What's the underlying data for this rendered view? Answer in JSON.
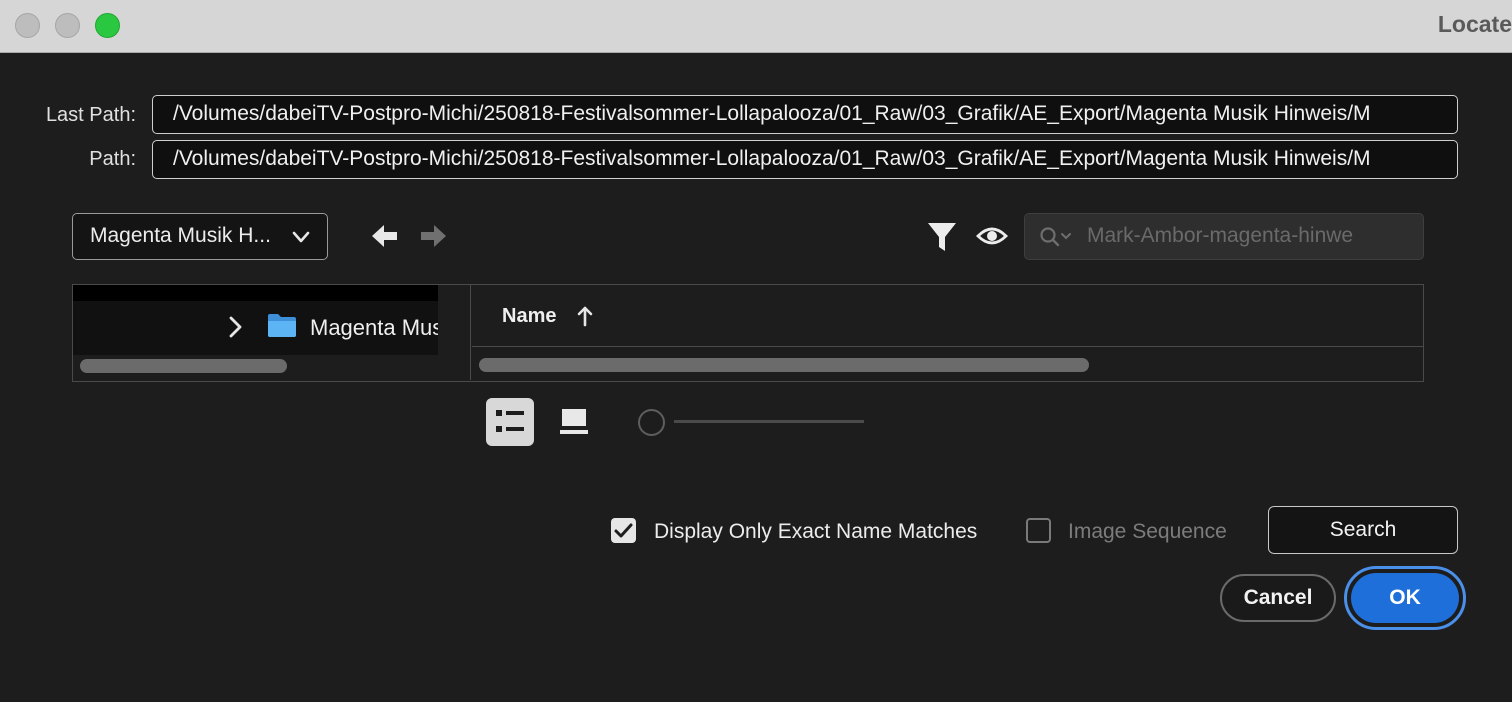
{
  "window": {
    "title": "Locate"
  },
  "paths": {
    "last_path_label": "Last Path:",
    "last_path_value": "/Volumes/dabeiTV-Postpro-Michi/250818-Festivalsommer-Lollapalooza/01_Raw/03_Grafik/AE_Export/Magenta Musik Hinweis/M",
    "path_label": "Path:",
    "path_value": "/Volumes/dabeiTV-Postpro-Michi/250818-Festivalsommer-Lollapalooza/01_Raw/03_Grafik/AE_Export/Magenta Musik Hinweis/M"
  },
  "toolbar": {
    "location_dropdown": "Magenta Musik H...",
    "back_icon": "arrow-left-icon",
    "forward_icon": "arrow-right-icon",
    "filter_icon": "funnel-icon",
    "preview_icon": "eye-icon",
    "search_placeholder": "Mark-Ambor-magenta-hinwe"
  },
  "browser": {
    "tree": {
      "items": [
        {
          "label": "Magenta Musik Hinweis",
          "icon": "folder-icon",
          "expanded": false
        }
      ]
    },
    "list": {
      "column_header": "Name",
      "sort": "ascending"
    }
  },
  "view": {
    "list_view_active": true,
    "thumbnail_size": 0
  },
  "options": {
    "exact_matches_label": "Display Only Exact Name Matches",
    "exact_matches_checked": true,
    "image_sequence_label": "Image Sequence",
    "image_sequence_checked": false,
    "image_sequence_enabled": false
  },
  "buttons": {
    "search": "Search",
    "cancel": "Cancel",
    "ok": "OK"
  },
  "colors": {
    "accent": "#1e6fd9",
    "accent_ring": "#4a8fe8",
    "background": "#1d1d1d",
    "traffic_max": "#2ac840",
    "folder": "#4ea9f0"
  }
}
